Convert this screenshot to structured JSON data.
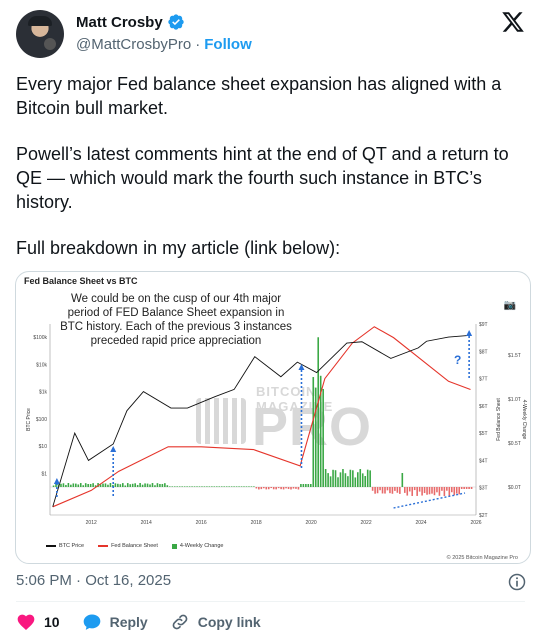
{
  "author": {
    "name": "Matt Crosby",
    "handle": "@MattCrosbyPro",
    "separator": "·",
    "follow_label": "Follow"
  },
  "tweet": {
    "paragraphs": [
      "Every major Fed balance sheet expansion has aligned with a Bitcoin bull market.",
      "Powell’s latest comments hint at the end of QT and a return to QE — which would mark the fourth such instance in BTC’s history.",
      "Full breakdown in my article (link below):"
    ]
  },
  "media": {
    "chart_title": "Fed Balance Sheet vs BTC",
    "annotation": "We could be on the cusp of our 4th major period of FED Balance Sheet expansion in BTC history. Each of the previous 3 instances preceded rapid price appreciation",
    "question_mark": "?",
    "watermark_top": "BITCOIN MAGAZINE",
    "watermark_main": "PRO",
    "copyright": "© 2025 Bitcoin Magazine Pro",
    "legend": [
      "BTC Price",
      "Fed Balance Sheet",
      "4-Weekly Change"
    ],
    "colors": {
      "btc": "#111111",
      "fed": "#e5352b",
      "change_pos": "#3aa845",
      "change_neg": "#e86a6a",
      "arrow": "#2a6fd6"
    }
  },
  "chart_data": {
    "type": "line",
    "title": "Fed Balance Sheet vs BTC",
    "x": [
      "2012",
      "2014",
      "2016",
      "2018",
      "2020",
      "2022",
      "2024",
      "2026"
    ],
    "y_left_label": "BTC Price",
    "y_left_ticks": [
      "$1",
      "$10",
      "$100",
      "$1k",
      "$10k",
      "$100k"
    ],
    "y_right_label": "Fed Balance Sheet",
    "y_right_ticks": [
      "$2T",
      "$3T",
      "$4T",
      "$5T",
      "$6T",
      "$7T",
      "$8T",
      "$9T"
    ],
    "y_right2_label": "4-Weekly Change",
    "y_right2_ticks": [
      "$0.0T",
      "$0.5T",
      "$1.0T",
      "$1.5T"
    ],
    "series": [
      {
        "name": "BTC Price",
        "x": [
          2010.6,
          2011.4,
          2011.9,
          2012.8,
          2013.3,
          2013.9,
          2014.9,
          2015.5,
          2016.5,
          2017.2,
          2017.95,
          2018.9,
          2019.5,
          2020.2,
          2021.3,
          2021.85,
          2022.9,
          2023.9,
          2024.2,
          2025.0,
          2025.8
        ],
        "values": [
          0.06,
          30,
          3,
          12,
          200,
          1000,
          250,
          250,
          650,
          1200,
          19000,
          3500,
          12000,
          5000,
          60000,
          67000,
          16500,
          40000,
          70000,
          100000,
          115000
        ]
      },
      {
        "name": "Fed Balance Sheet",
        "unit": "$T",
        "x": [
          2010.6,
          2012.0,
          2013.0,
          2014.8,
          2016.0,
          2017.9,
          2019.6,
          2020.5,
          2021.5,
          2022.3,
          2023.0,
          2024.0,
          2025.0,
          2025.8
        ],
        "values": [
          2.3,
          2.9,
          3.6,
          4.5,
          4.5,
          4.4,
          3.8,
          7.0,
          8.3,
          8.9,
          8.5,
          7.7,
          6.9,
          6.6
        ]
      }
    ]
  },
  "timestamp": "5:06 PM · Oct 16, 2025",
  "actions": {
    "likes": "10",
    "reply_label": "Reply",
    "copy_label": "Copy link"
  }
}
